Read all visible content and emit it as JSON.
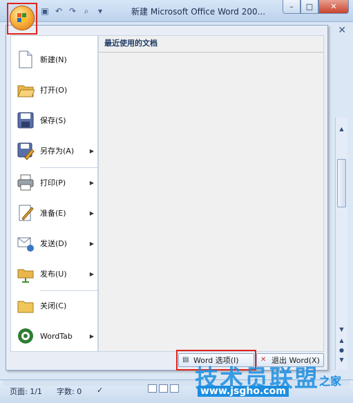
{
  "window": {
    "title": "新建 Microsoft Office Word 200...",
    "min": "–",
    "max": "□",
    "close": "✕"
  },
  "qat": [
    "save-icon",
    "undo-icon",
    "redo-icon",
    "print-preview-icon",
    "customize-icon"
  ],
  "doc_close": "✕",
  "menu": {
    "recent_header": "最近使用的文档",
    "items": [
      {
        "label": "新建(N)",
        "icon": "new-document-icon",
        "arrow": false
      },
      {
        "label": "打开(O)",
        "icon": "open-folder-icon",
        "arrow": false
      },
      {
        "label": "保存(S)",
        "icon": "save-disk-icon",
        "arrow": false
      },
      {
        "label": "另存为(A)",
        "icon": "save-as-icon",
        "arrow": true
      },
      {
        "label": "打印(P)",
        "icon": "printer-icon",
        "arrow": true
      },
      {
        "label": "准备(E)",
        "icon": "prepare-icon",
        "arrow": true
      },
      {
        "label": "发送(D)",
        "icon": "send-icon",
        "arrow": true
      },
      {
        "label": "发布(U)",
        "icon": "publish-icon",
        "arrow": true
      },
      {
        "label": "关闭(C)",
        "icon": "close-folder-icon",
        "arrow": false
      },
      {
        "label": "WordTab",
        "icon": "wordtab-icon",
        "arrow": true
      }
    ],
    "options_button": "Word 选项(I)",
    "exit_button": "退出 Word(X)"
  },
  "status": {
    "page": "页面: 1/1",
    "words": "字数: 0"
  },
  "watermark": {
    "main": "技术员联盟",
    "url": "www.jsgho.com",
    "suffix": "之家"
  }
}
